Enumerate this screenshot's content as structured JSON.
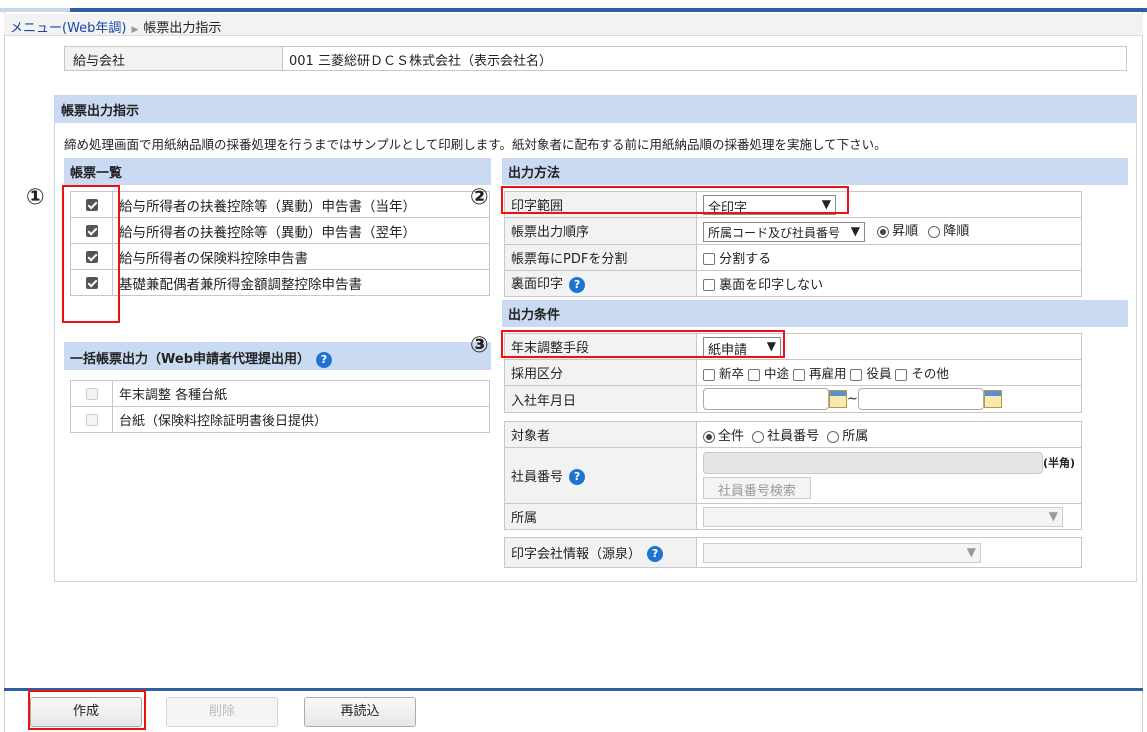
{
  "breadcrumb": {
    "menu": "メニュー(Web年調)",
    "current": "帳票出力指示"
  },
  "company": {
    "label": "給与会社",
    "value": "001 三菱総研ＤＣＳ株式会社（表示会社名）"
  },
  "main": {
    "title": "帳票出力指示",
    "notice": "締め処理画面で用紙納品順の採番処理を行うまではサンプルとして印刷します。紙対象者に配布する前に用紙納品順の採番処理を実施して下さい。"
  },
  "list": {
    "title": "帳票一覧",
    "items": [
      {
        "label": "給与所得者の扶養控除等（異動）申告書（当年）",
        "checked": true
      },
      {
        "label": "給与所得者の扶養控除等（異動）申告書（翌年）",
        "checked": true
      },
      {
        "label": "給与所得者の保険料控除申告書",
        "checked": true
      },
      {
        "label": "基礎兼配偶者兼所得金額調整控除申告書",
        "checked": true
      }
    ]
  },
  "bulk": {
    "title": "一括帳票出力（Web申請者代理提出用）",
    "items": [
      {
        "label": "年末調整 各種台紙",
        "checked": false
      },
      {
        "label": "台紙（保険料控除証明書後日提供）",
        "checked": false
      }
    ]
  },
  "output_method": {
    "title": "出力方法",
    "print_range": {
      "label": "印字範囲",
      "value": "全印字"
    },
    "order": {
      "label": "帳票出力順序",
      "value": "所属コード及び社員番号",
      "asc": "昇順",
      "desc": "降順"
    },
    "split_pdf": {
      "label": "帳票毎にPDFを分割",
      "option": "分割する"
    },
    "back_print": {
      "label": "裏面印字",
      "option": "裏面を印字しない"
    }
  },
  "conditions": {
    "title": "出力条件",
    "method": {
      "label": "年末調整手段",
      "value": "紙申請"
    },
    "hire_type": {
      "label": "採用区分",
      "options": [
        "新卒",
        "中途",
        "再雇用",
        "役員",
        "その他"
      ]
    },
    "hire_date": {
      "label": "入社年月日",
      "tilde": "~"
    },
    "target": {
      "label": "対象者",
      "options": [
        "全件",
        "社員番号",
        "所属"
      ]
    },
    "employee_no": {
      "label": "社員番号",
      "hint": "(半角)",
      "search": "社員番号検索"
    },
    "dept": {
      "label": "所属"
    },
    "company_info": {
      "label": "印字会社情報（源泉）"
    }
  },
  "markers": [
    "①",
    "②",
    "③"
  ],
  "buttons": {
    "create": "作成",
    "delete": "削除",
    "reload": "再読込"
  },
  "icons": {
    "help": "?"
  }
}
